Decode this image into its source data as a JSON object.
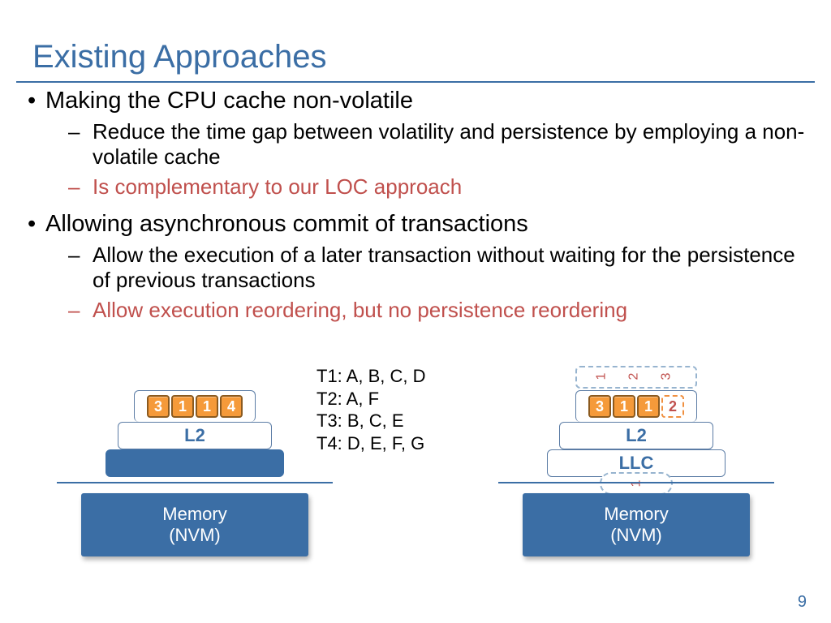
{
  "title": "Existing Approaches",
  "bullets": [
    {
      "text": "Making the CPU cache non-volatile",
      "sub": [
        {
          "text": "Reduce the time gap between volatility and persistence by employing a non-volatile cache",
          "red": false
        },
        {
          "text": "Is complementary to our LOC approach",
          "red": true
        }
      ]
    },
    {
      "text": "Allowing asynchronous commit of transactions",
      "sub": [
        {
          "text": "Allow the execution of a later transaction without waiting for the persistence of previous transactions",
          "red": false
        },
        {
          "text": "Allow execution reordering, but no persistence reordering",
          "red": true
        }
      ]
    }
  ],
  "txns": {
    "t1": "T1: A, B, C, D",
    "t2": "T2: A, F",
    "t3": "T3: B, C, E",
    "t4": "T4: D, E, F, G"
  },
  "left_diag": {
    "l1_chips": [
      "3",
      "1",
      "1",
      "4"
    ],
    "l2_label": "L2",
    "mem1": "Memory",
    "mem2": "(NVM)"
  },
  "right_diag": {
    "top_labels": [
      "1",
      "2",
      "3"
    ],
    "l1_chips": [
      "3",
      "1",
      "1",
      "2"
    ],
    "l2_label": "L2",
    "llc_label": "LLC",
    "nvm_label": "1",
    "mem1": "Memory",
    "mem2": "(NVM)"
  },
  "page_number": "9"
}
